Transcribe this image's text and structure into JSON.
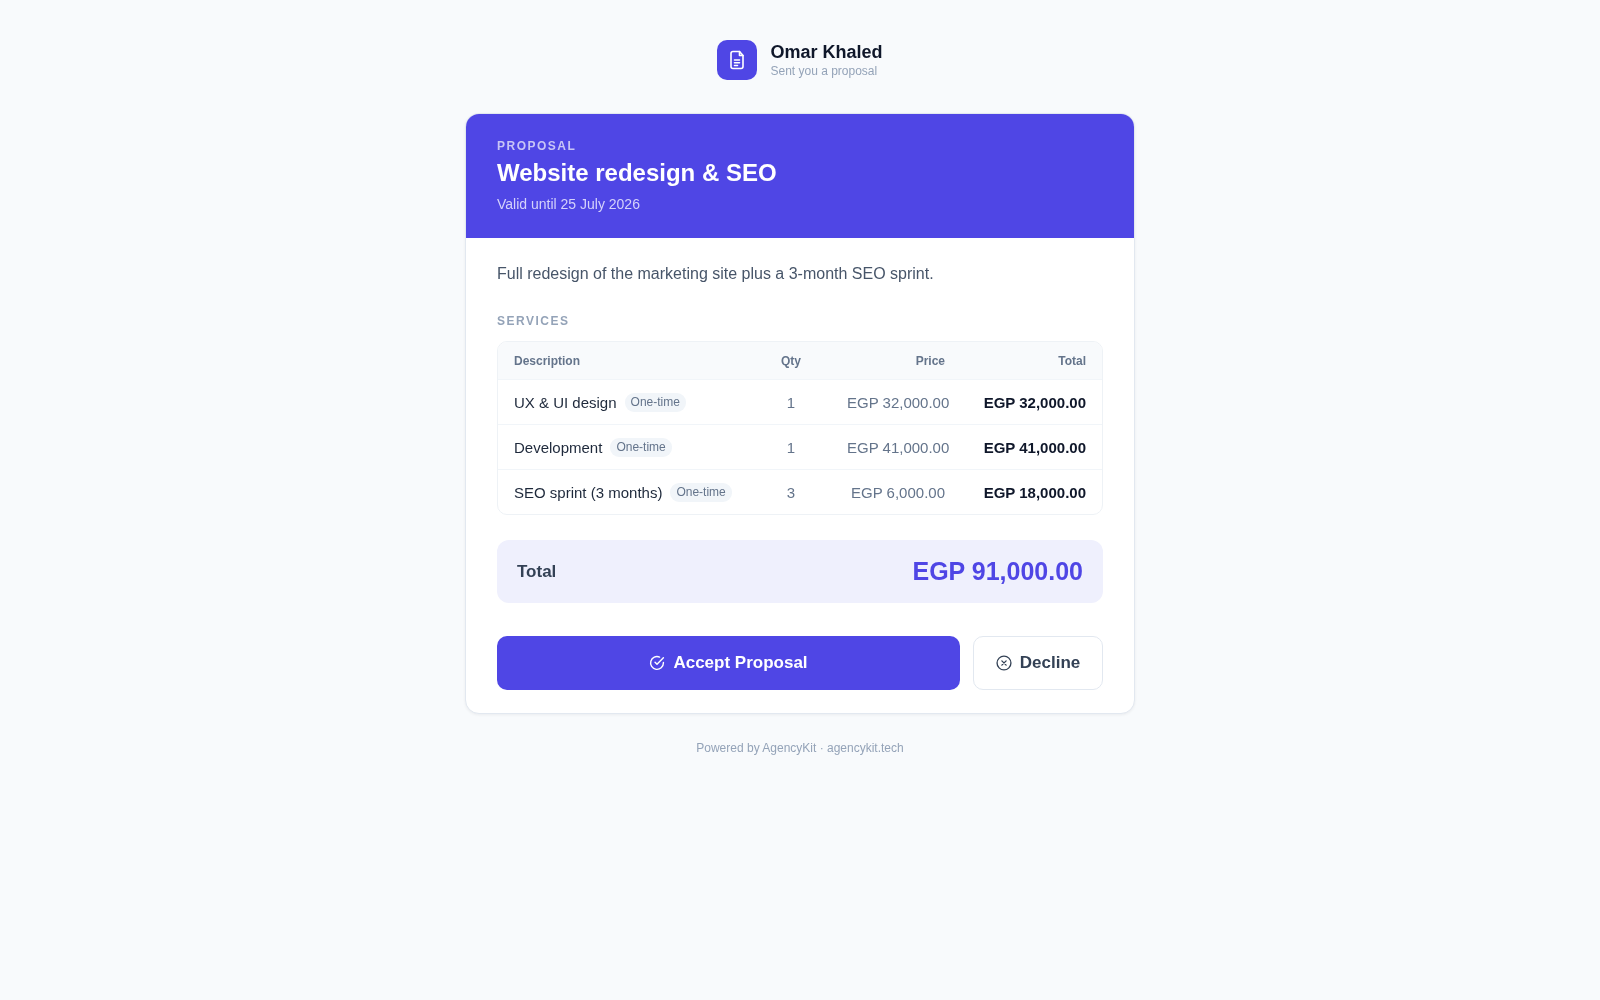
{
  "sender": {
    "name": "Omar Khaled",
    "subtitle": "Sent you a proposal"
  },
  "proposal": {
    "eyebrow": "PROPOSAL",
    "title": "Website redesign & SEO",
    "valid_until": "Valid until 25 July 2026",
    "description": "Full redesign of the marketing site plus a 3-month SEO sprint."
  },
  "services": {
    "heading": "SERVICES",
    "columns": [
      "Description",
      "Qty",
      "Price",
      "Total"
    ],
    "rows": [
      {
        "description": "UX & UI design",
        "billing": "One-time",
        "qty": "1",
        "price": "EGP 32,000.00",
        "total": "EGP 32,000.00"
      },
      {
        "description": "Development",
        "billing": "One-time",
        "qty": "1",
        "price": "EGP 41,000.00",
        "total": "EGP 41,000.00"
      },
      {
        "description": "SEO sprint (3 months)",
        "billing": "One-time",
        "qty": "3",
        "price": "EGP 6,000.00",
        "total": "EGP 18,000.00"
      }
    ]
  },
  "total": {
    "label": "Total",
    "amount": "EGP 91,000.00"
  },
  "actions": [
    {
      "kind": "accept",
      "label": "Accept Proposal"
    },
    {
      "kind": "decline",
      "label": "Decline"
    }
  ],
  "footer": "Powered by AgencyKit · agencykit.tech"
}
